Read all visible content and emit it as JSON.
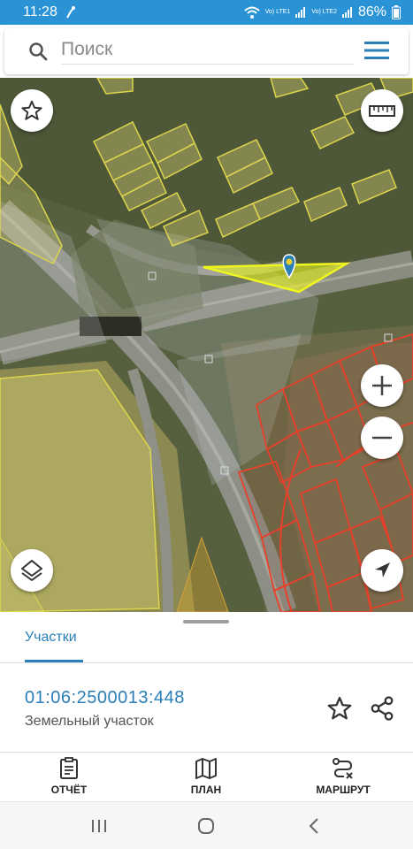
{
  "status_bar": {
    "time": "11:28",
    "battery": "86%",
    "sim1_label": "Vo) LTE1",
    "sim2_label": "Vo) LTE2"
  },
  "search": {
    "placeholder": "Поиск",
    "icon": "search-icon",
    "menu_icon": "menu-icon"
  },
  "map": {
    "buttons": [
      "star-icon",
      "ruler-icon",
      "zoom-in-icon",
      "zoom-out-icon",
      "layers-icon",
      "location-arrow-icon"
    ],
    "marker_icon": "location-pin-icon",
    "colors": {
      "parcel_fill": "#e8e07a",
      "parcel_border": "#d9d44a",
      "selected_parcel": "#e6f21a",
      "parcel_red": "#e8402a",
      "marker": "#2a7fb8"
    }
  },
  "panel": {
    "tab_label": "Участки",
    "parcel_id": "01:06:2500013:448",
    "parcel_type": "Земельный участок",
    "actions": [
      {
        "label": "ОТЧЁТ",
        "icon": "report-icon"
      },
      {
        "label": "ПЛАН",
        "icon": "map-plan-icon"
      },
      {
        "label": "МАРШРУТ",
        "icon": "route-icon"
      }
    ],
    "accent": "#2a7fb8"
  }
}
